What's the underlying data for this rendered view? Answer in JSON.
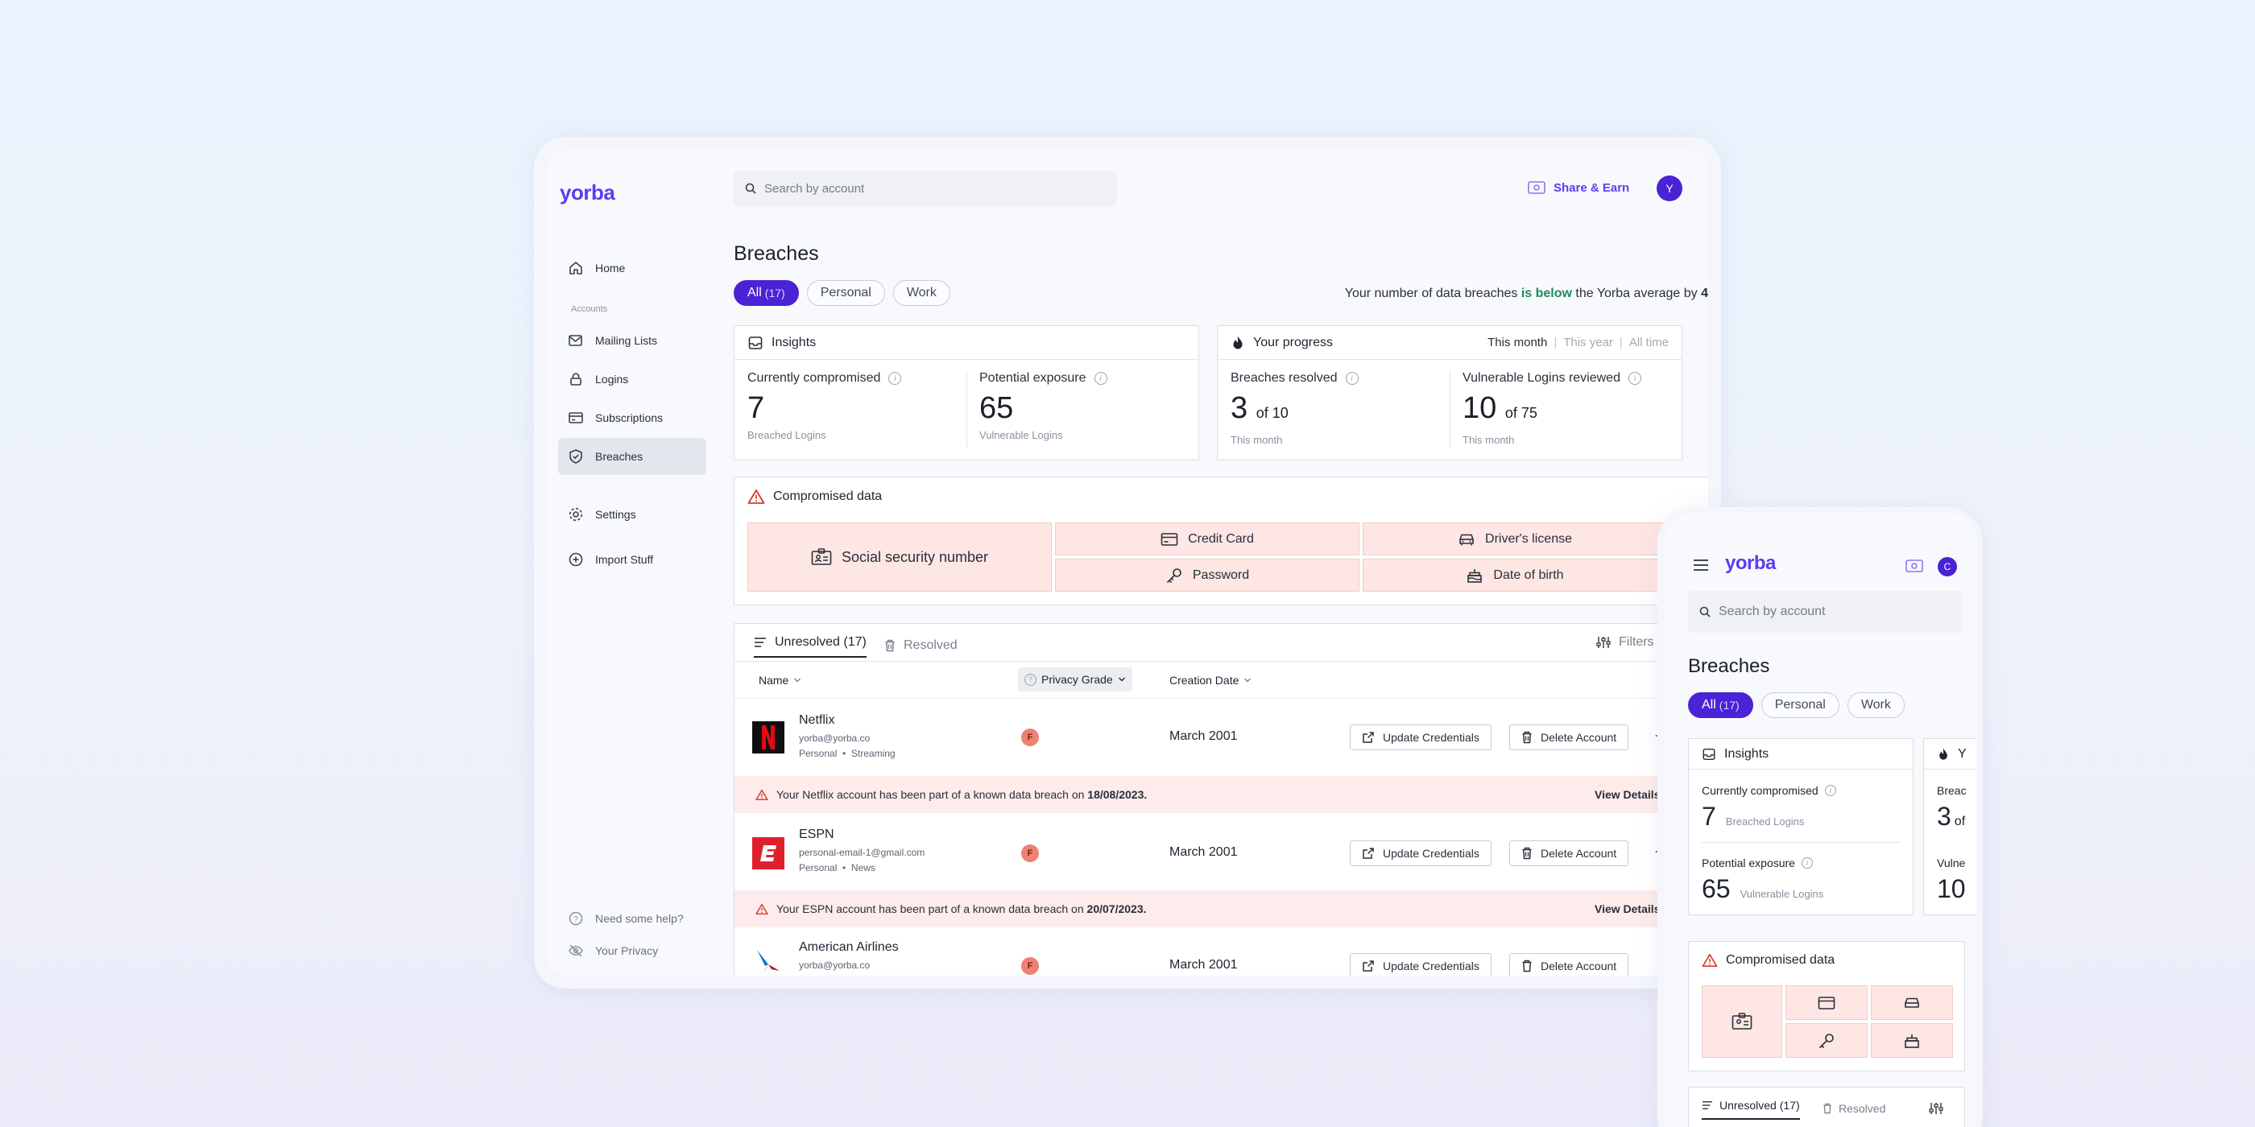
{
  "brand": {
    "logo": "yorba",
    "accent": "#5b3df0",
    "alert": "#fdeceb",
    "danger": "#d63a2b",
    "success": "#1f8a5a"
  },
  "desktop": {
    "search_placeholder": "Search by account",
    "share_label": "Share & Earn",
    "avatar_initial": "Y",
    "sidebar": {
      "home": "Home",
      "section_label": "Accounts",
      "items": [
        {
          "label": "Mailing Lists",
          "icon": "mail-icon"
        },
        {
          "label": "Logins",
          "icon": "lock-icon"
        },
        {
          "label": "Subscriptions",
          "icon": "card-icon"
        },
        {
          "label": "Breaches",
          "icon": "shield-icon"
        }
      ],
      "settings": "Settings",
      "import": "Import Stuff",
      "help": "Need some help?",
      "privacy": "Your Privacy"
    },
    "page_title": "Breaches",
    "filters": [
      {
        "label": "All",
        "count": "(17)"
      },
      {
        "label": "Personal"
      },
      {
        "label": "Work"
      }
    ],
    "comparison": {
      "prefix": "Your number of data breaches ",
      "emph": "is below",
      "middle": " the Yorba average by ",
      "value": "4"
    },
    "insights": {
      "title": "Insights",
      "compromised": {
        "label": "Currently compromised",
        "value": "7",
        "sub": "Breached Logins"
      },
      "exposure": {
        "label": "Potential exposure",
        "value": "65",
        "sub": "Vulnerable Logins"
      }
    },
    "progress": {
      "title": "Your progress",
      "ranges": [
        "This month",
        "This year",
        "All time"
      ],
      "resolved": {
        "label": "Breaches resolved",
        "value": "3",
        "of": "of 10",
        "sub": "This month"
      },
      "reviewed": {
        "label": "Vulnerable Logins reviewed",
        "value": "10",
        "of": "of 75",
        "sub": "This month"
      }
    },
    "compromised": {
      "title": "Compromised data",
      "items": [
        "Social security number",
        "Credit Card",
        "Driver's license",
        "Password",
        "Date of birth"
      ]
    },
    "table": {
      "tabs": [
        "Unresolved (17)",
        "Resolved"
      ],
      "filters_label": "Filters",
      "columns": [
        "Name",
        "Privacy Grade",
        "Creation Date"
      ],
      "rows": [
        {
          "name": "Netflix",
          "email": "yorba@yorba.co",
          "tags": "Personal  •  Streaming",
          "grade": "F",
          "date": "March 2001",
          "alert_prefix": "Your Netflix account has been part of a known data breach on ",
          "alert_date": "18/08/2023."
        },
        {
          "name": "ESPN",
          "email": "personal-email-1@gmail.com",
          "tags": "Personal  •  News",
          "grade": "F",
          "date": "March 2001",
          "alert_prefix": "Your ESPN account has been part of a known data breach on ",
          "alert_date": "20/07/2023."
        },
        {
          "name": "American Airlines",
          "email": "yorba@yorba.co",
          "grade": "F",
          "date": "March 2001"
        }
      ],
      "update_label": "Update Credentials",
      "delete_label": "Delete Account",
      "view_details": "View Details"
    }
  },
  "mobile": {
    "logo": "yorba",
    "avatar_initial": "C",
    "search_placeholder": "Search by account",
    "page_title": "Breaches",
    "filters": [
      {
        "label": "All",
        "count": "(17)"
      },
      {
        "label": "Personal"
      },
      {
        "label": "Work"
      }
    ],
    "insights_title": "Insights",
    "compromised": {
      "label": "Currently compromised",
      "value": "7",
      "sub": "Breached Logins"
    },
    "exposure": {
      "label": "Potential exposure",
      "value": "65",
      "sub": "Vulnerable Logins"
    },
    "progress_peek": {
      "title": "Y",
      "r1": "Breac",
      "v1": "3",
      "of1": "of",
      "r2": "Vulne",
      "v2": "10"
    },
    "compromised_title": "Compromised data",
    "tabs": [
      "Unresolved (17)",
      "Resolved"
    ]
  }
}
